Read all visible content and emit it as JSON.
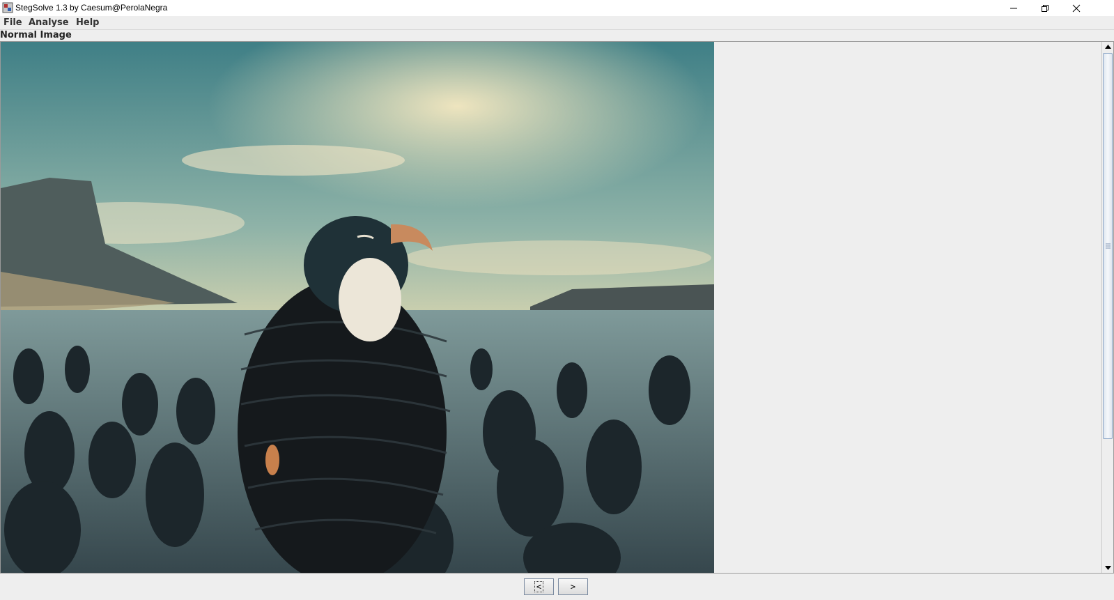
{
  "window": {
    "title": "StegSolve 1.3 by Caesum@PerolaNegra",
    "controls": [
      "minimize-icon",
      "restore-icon",
      "close-icon"
    ]
  },
  "menu": {
    "items": [
      "File",
      "Analyse",
      "Help"
    ]
  },
  "view": {
    "label": "Normal Image",
    "image_description": "Penguin wrapped in cables standing among many cable-wrapped penguins in shallow water"
  },
  "navigation": {
    "prev_label": "<",
    "next_label": ">"
  },
  "icons": {
    "app": "stegsolve-app-icon",
    "scroll_up": "arrow-up-icon",
    "scroll_down": "arrow-down-icon"
  }
}
